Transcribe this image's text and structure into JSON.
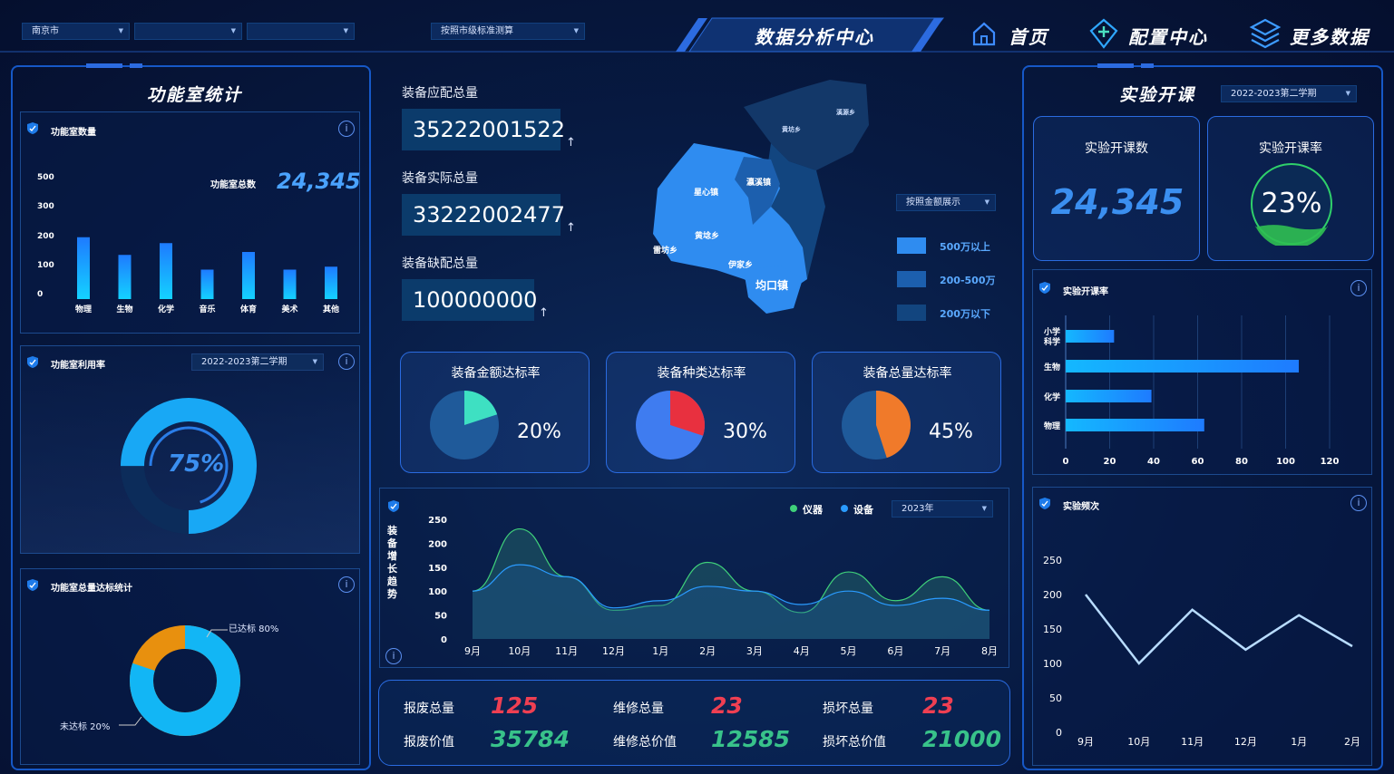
{
  "header": {
    "city_select": "南京市",
    "select2": "",
    "select3": "",
    "calc_select": "按照市级标准测算",
    "title": "数据分析中心",
    "nav": [
      {
        "label": "首页",
        "icon": "home-icon"
      },
      {
        "label": "配置中心",
        "icon": "plus-shield-icon"
      },
      {
        "label": "更多数据",
        "icon": "layers-icon"
      }
    ]
  },
  "left": {
    "title": "功能室统计",
    "count_panel": {
      "title": "功能室数量",
      "total_label": "功能室总数",
      "total_value": "24,345",
      "chart_data": {
        "type": "bar",
        "categories": [
          "物理",
          "生物",
          "化学",
          "音乐",
          "体育",
          "美术",
          "其他"
        ],
        "values": [
          210,
          150,
          190,
          100,
          160,
          100,
          110
        ],
        "y_ticks": [
          "500",
          "300",
          "200",
          "100",
          "0"
        ]
      }
    },
    "usage_panel": {
      "title": "功能室利用率",
      "term": "2022-2023第二学期",
      "percent": "75%",
      "value": 0.75
    },
    "standard_panel": {
      "title": "功能室总量达标统计",
      "chart_data": {
        "type": "pie",
        "labels": [
          "已达标 80%",
          "未达标  20%"
        ],
        "values": [
          80,
          20
        ]
      }
    }
  },
  "center": {
    "kpis": [
      {
        "label": "装备应配总量",
        "value": "35222001522",
        "arrow": "↑"
      },
      {
        "label": "装备实际总量",
        "value": "33222002477",
        "arrow": "↑"
      },
      {
        "label": "装备缺配总量",
        "value": "100000000",
        "arrow": "↑"
      }
    ],
    "map": {
      "towns": [
        "星心镇",
        "瀛溪镇",
        "黄埝乡",
        "雷坊乡",
        "伊家乡",
        "均口镇",
        "黄坊乡",
        "溪源乡"
      ],
      "legend_select": "按照金额展示",
      "legend": [
        {
          "label": "500万以上",
          "color": "#2f8cf0"
        },
        {
          "label": "200-500万",
          "color": "#1c5fae"
        },
        {
          "label": "200万以下",
          "color": "#12457f"
        }
      ]
    },
    "rate_cards": [
      {
        "title": "装备金额达标率",
        "value": "20%",
        "fraction": 0.2,
        "color": "#3ee0c2",
        "base": "#1f5a9a"
      },
      {
        "title": "装备种类达标率",
        "value": "30%",
        "fraction": 0.3,
        "color": "#e8303f",
        "base": "#3f7cf0"
      },
      {
        "title": "装备总量达标率",
        "value": "45%",
        "fraction": 0.45,
        "color": "#f07a2a",
        "base": "#1f5a9a"
      }
    ],
    "trend": {
      "title": "装备增长趋势",
      "legend": [
        "仪器",
        "设备"
      ],
      "year": "2023年",
      "chart_data": {
        "type": "area",
        "x": [
          "9月",
          "10月",
          "11月",
          "12月",
          "1月",
          "2月",
          "3月",
          "4月",
          "5月",
          "6月",
          "7月",
          "8月"
        ],
        "y_ticks": [
          "250",
          "200",
          "150",
          "100",
          "50",
          "0"
        ],
        "series": [
          {
            "name": "仪器",
            "values": [
              100,
              230,
              130,
              60,
              70,
              160,
              100,
              55,
              140,
              80,
              130,
              60
            ]
          },
          {
            "name": "设备",
            "values": [
              100,
              155,
              130,
              65,
              80,
              110,
              100,
              72,
              100,
              70,
              85,
              60
            ]
          }
        ]
      }
    },
    "stats": [
      {
        "label": "报废总量",
        "value": "125",
        "cls": "red"
      },
      {
        "label": "维修总量",
        "value": "23",
        "cls": "red"
      },
      {
        "label": "损坏总量",
        "value": "23",
        "cls": "red"
      },
      {
        "label": "报废价值",
        "value": "35784",
        "cls": "grn"
      },
      {
        "label": "维修总价值",
        "value": "12585",
        "cls": "grn"
      },
      {
        "label": "损坏总价值",
        "value": "21000",
        "cls": "grn"
      }
    ]
  },
  "right": {
    "title": "实验开课",
    "term": "2022-2023第二学期",
    "open_count_label": "实验开课数",
    "open_count": "24,345",
    "open_rate_label": "实验开课率",
    "open_rate": "23%",
    "open_rate_value": 0.23,
    "rate_panel": {
      "title": "实验开课率",
      "chart_data": {
        "type": "bar",
        "categories": [
          "小学科学",
          "生物",
          "化学",
          "物理"
        ],
        "values": [
          22,
          106,
          39,
          63
        ],
        "x_ticks": [
          "0",
          "20",
          "40",
          "60",
          "80",
          "100",
          "120"
        ]
      }
    },
    "freq_panel": {
      "title": "实验频次",
      "chart_data": {
        "type": "line",
        "x": [
          "9月",
          "10月",
          "11月",
          "12月",
          "1月",
          "2月"
        ],
        "y_ticks": [
          "250",
          "200",
          "150",
          "100",
          "50",
          "0"
        ],
        "values": [
          200,
          100,
          178,
          120,
          170,
          125
        ]
      }
    }
  }
}
